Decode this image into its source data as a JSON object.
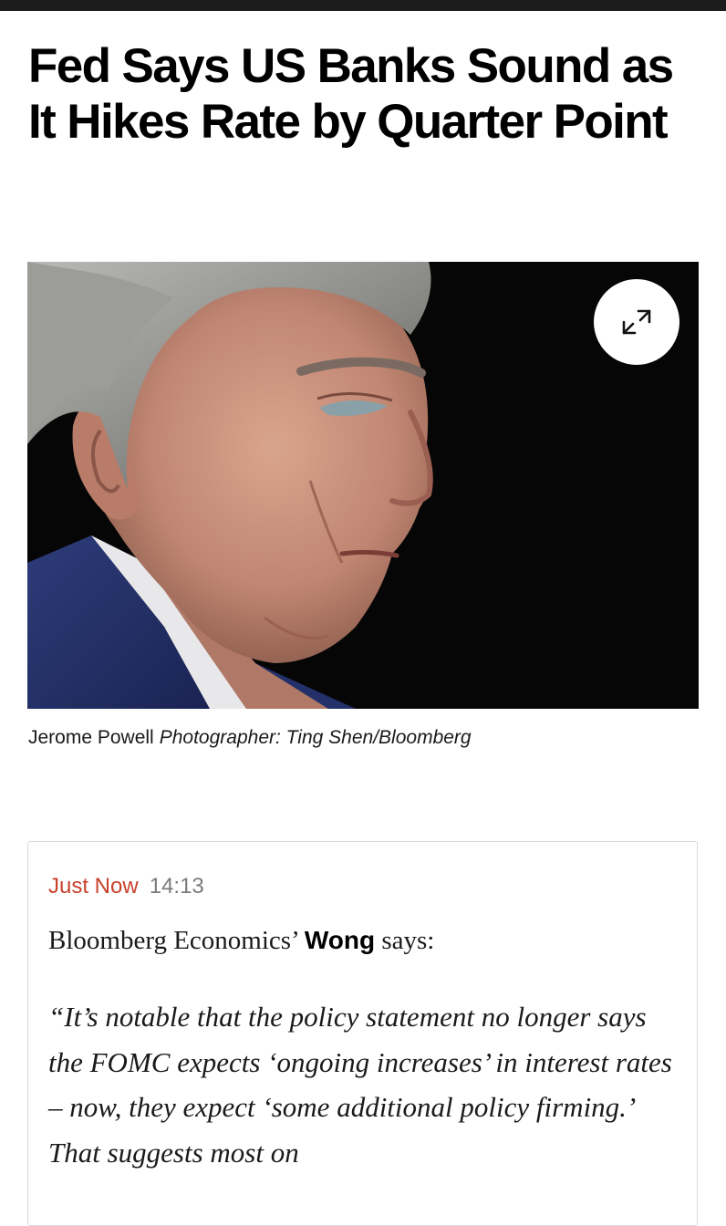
{
  "article": {
    "headline": "Fed Says US Banks Sound as It Hikes Rate by Quarter Point"
  },
  "image": {
    "caption_subject": "Jerome Powell",
    "caption_credit": "Photographer: Ting Shen/Bloomberg",
    "expand_icon": "expand-arrows-icon"
  },
  "live_update": {
    "label": "Just Now",
    "time": "14:13",
    "byline_prefix": "Bloomberg Economics’",
    "byline_name": "Wong",
    "byline_suffix": "says:",
    "quote": "“It’s notable that the policy statement no longer says the FOMC expects ‘ongoing increases’ in interest rates – now, they expect ‘some additional policy firming.’ That suggests most on"
  },
  "colors": {
    "accent_red": "#c8412b",
    "timestamp_gray": "#7a7a7a",
    "top_bar": "#1c1c1c"
  }
}
